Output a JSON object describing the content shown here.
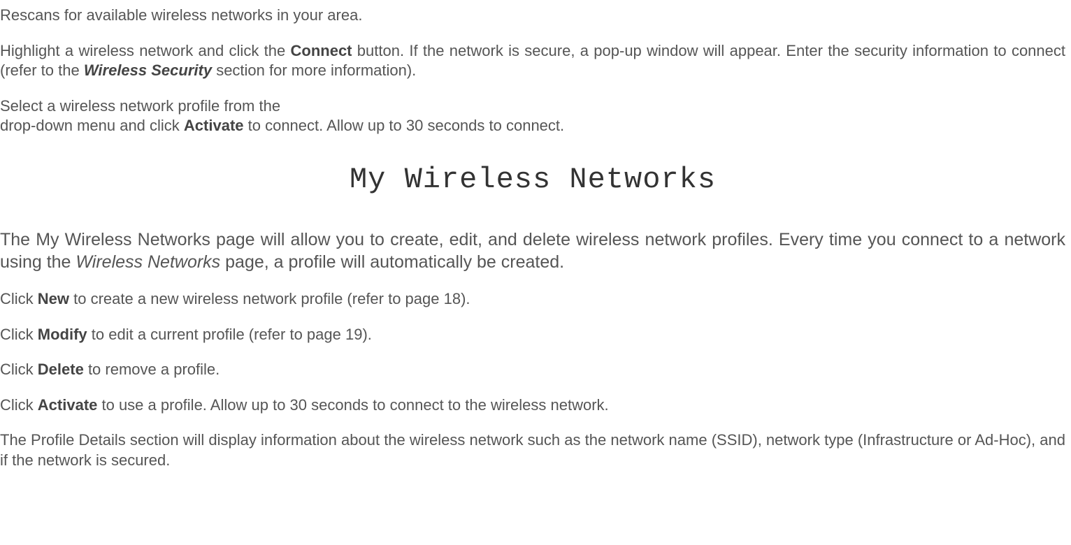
{
  "paragraphs": {
    "rescan": "Rescans for available wireless networks in your area.",
    "highlight_pre": "Highlight a wireless network and click the ",
    "highlight_connect": "Connect",
    "highlight_mid": " button. If the network is secure, a pop-up window will appear. Enter the security information to connect (refer to the ",
    "highlight_wireless_security": "Wireless Security",
    "highlight_post": " section for more information).",
    "select_line1": "Select a wireless network profile from the",
    "select_line2_pre": "drop-down menu and click ",
    "select_activate": "Activate",
    "select_line2_post": " to connect. Allow up to 30 seconds to connect.",
    "heading": "My Wireless Networks",
    "intro_pre": "The My Wireless Networks page will allow you to create, edit, and delete wireless network profiles. Every time you connect to a network using the ",
    "intro_italic": "Wireless Networks",
    "intro_post": " page, a profile will automatically be created.",
    "new_pre": "Click ",
    "new_bold": "New",
    "new_post": " to create a new wireless network profile (refer to page 18).",
    "modify_pre": "Click ",
    "modify_bold": "Modify",
    "modify_post": " to edit a current profile (refer to page 19).",
    "delete_pre": "Click ",
    "delete_bold": "Delete",
    "delete_post": " to remove a profile.",
    "activate_pre": "Click ",
    "activate_bold": "Activate",
    "activate_post": " to use a profile. Allow up to 30 seconds to connect to the wireless network.",
    "details": "The Profile Details section will display information about the wireless network such as the network name (SSID), network type (Infrastructure or Ad-Hoc), and if the network is secured."
  }
}
